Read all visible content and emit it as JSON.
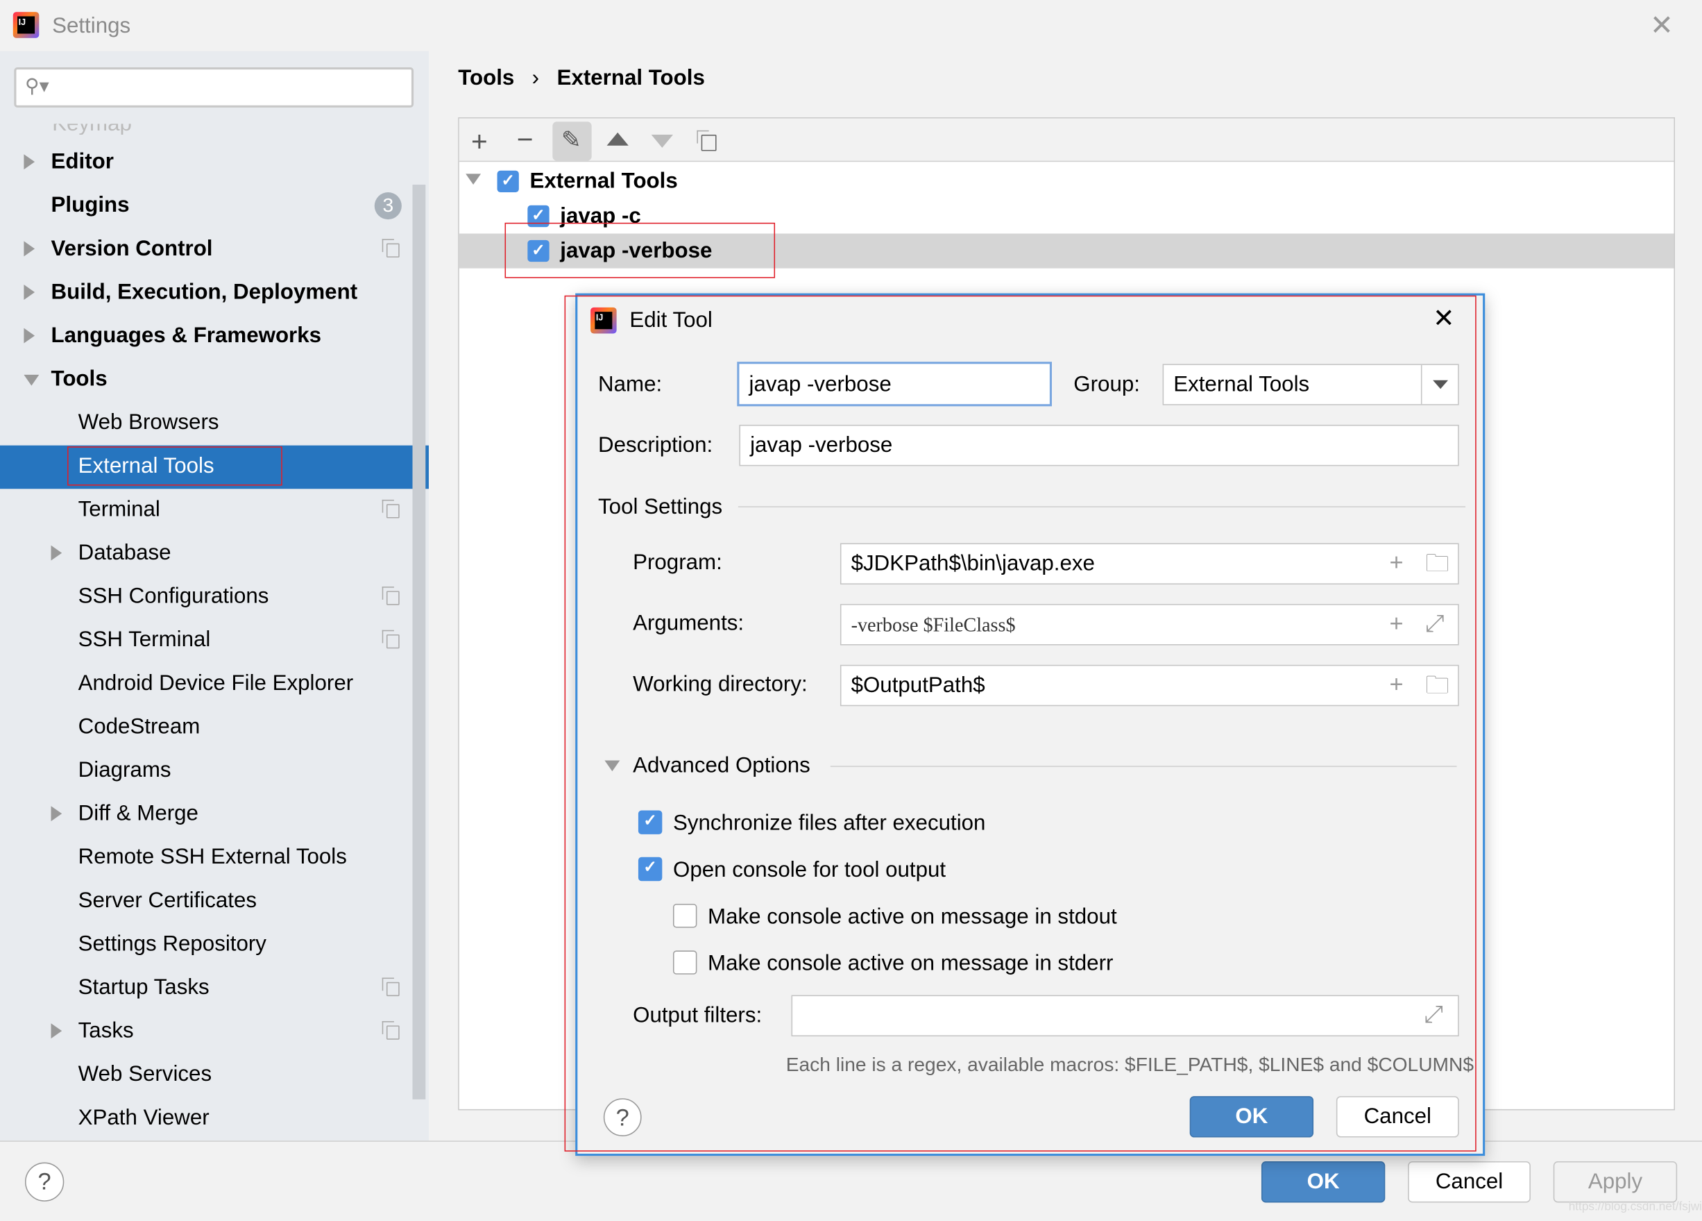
{
  "window": {
    "title": "Settings"
  },
  "sidebar": {
    "search_placeholder": "",
    "partial_item": "Keymap",
    "items": [
      {
        "label": "Editor",
        "bold": true
      },
      {
        "label": "Plugins",
        "bold": true,
        "badge": "3"
      },
      {
        "label": "Version Control",
        "bold": true
      },
      {
        "label": "Build, Execution, Deployment",
        "bold": true
      },
      {
        "label": "Languages & Frameworks",
        "bold": true
      },
      {
        "label": "Tools",
        "bold": true
      },
      {
        "label": "Web Browsers"
      },
      {
        "label": "External Tools",
        "selected": true
      },
      {
        "label": "Terminal"
      },
      {
        "label": "Database"
      },
      {
        "label": "SSH Configurations"
      },
      {
        "label": "SSH Terminal"
      },
      {
        "label": "Android Device File Explorer"
      },
      {
        "label": "CodeStream"
      },
      {
        "label": "Diagrams"
      },
      {
        "label": "Diff & Merge"
      },
      {
        "label": "Remote SSH External Tools"
      },
      {
        "label": "Server Certificates"
      },
      {
        "label": "Settings Repository"
      },
      {
        "label": "Startup Tasks"
      },
      {
        "label": "Tasks"
      },
      {
        "label": "Web Services"
      },
      {
        "label": "XPath Viewer"
      }
    ]
  },
  "breadcrumb": {
    "parent": "Tools",
    "separator": "›",
    "current": "External Tools"
  },
  "tree": {
    "group": {
      "label": "External Tools",
      "checked": true
    },
    "items": [
      {
        "label": "javap -c",
        "checked": true
      },
      {
        "label": "javap -verbose",
        "checked": true,
        "selected": true
      }
    ]
  },
  "dialog": {
    "title": "Edit Tool",
    "name_label": "Name:",
    "name_value": "javap -verbose",
    "group_label": "Group:",
    "group_value": "External Tools",
    "description_label": "Description:",
    "description_value": "javap -verbose",
    "tool_settings": "Tool Settings",
    "program_label": "Program:",
    "program_value": "$JDKPath$\\bin\\javap.exe",
    "arguments_label": "Arguments:",
    "arguments_value": "-verbose $FileClass$",
    "workdir_label": "Working directory:",
    "workdir_value": "$OutputPath$",
    "advanced": "Advanced Options",
    "sync": {
      "label": "Synchronize files after execution",
      "checked": true
    },
    "console": {
      "label": "Open console for tool output",
      "checked": true
    },
    "stdout": {
      "label": "Make console active on message in stdout",
      "checked": false
    },
    "stderr": {
      "label": "Make console active on message in stderr",
      "checked": false
    },
    "filters_label": "Output filters:",
    "filters_value": "",
    "hint": "Each line is a regex, available macros: $FILE_PATH$, $LINE$ and $COLUMN$",
    "ok": "OK",
    "cancel": "Cancel",
    "help": "?"
  },
  "footer": {
    "ok": "OK",
    "cancel": "Cancel",
    "apply": "Apply",
    "help": "?",
    "watermark": "https://blog.csdn.net/fsjwin"
  },
  "colors": {
    "accent": "#2675bf",
    "checkbox": "#4a90e2",
    "button": "#4a88c7",
    "highlight_box": "#e0202a"
  }
}
